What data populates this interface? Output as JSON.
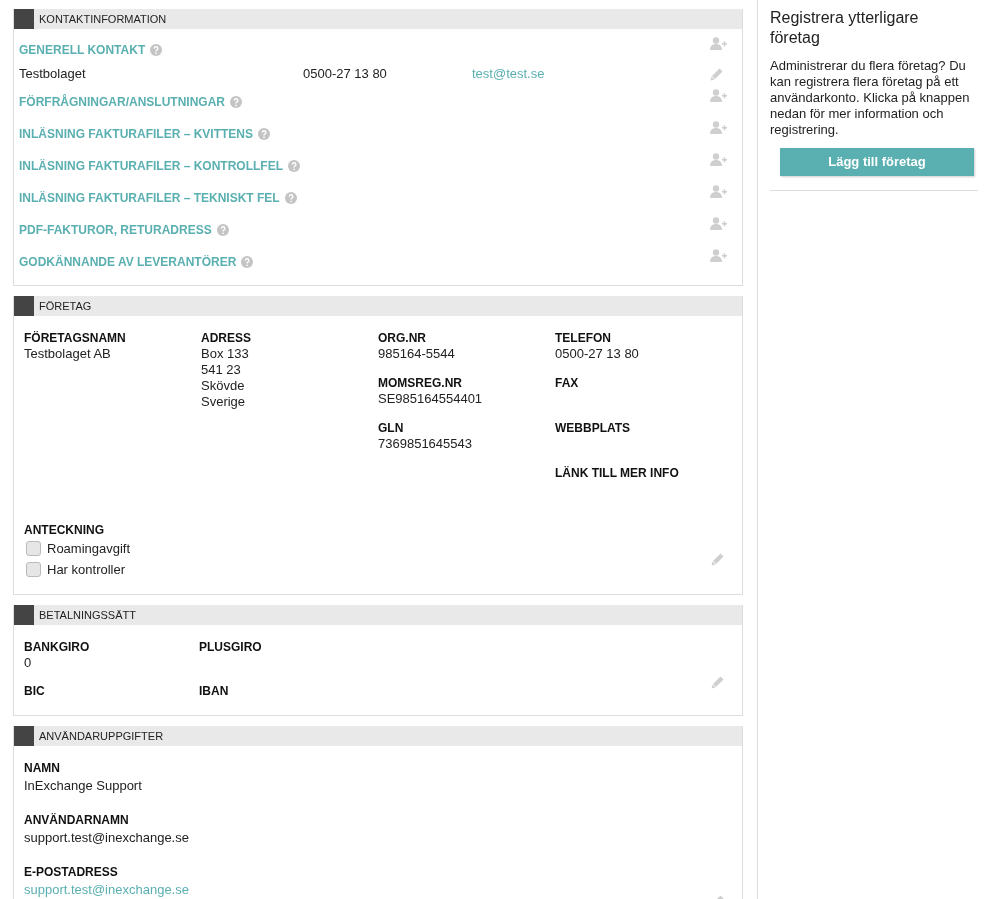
{
  "contact_section": {
    "title": "KONTAKTINFORMATION",
    "groups": [
      {
        "title": "GENERELL KONTAKT",
        "contacts": [
          {
            "name": "Testbolaget",
            "phone": "0500-27 13 80",
            "email": "test@test.se"
          }
        ]
      },
      {
        "title": "FÖRFRÅGNINGAR/ANSLUTNINGAR"
      },
      {
        "title": "INLÄSNING FAKTURAFILER – KVITTENS"
      },
      {
        "title": "INLÄSNING FAKTURAFILER – KONTROLLFEL"
      },
      {
        "title": "INLÄSNING FAKTURAFILER – TEKNISKT FEL"
      },
      {
        "title": "PDF-FAKTUROR, RETURADRESS"
      },
      {
        "title": "GODKÄNNANDE AV LEVERANTÖRER"
      }
    ]
  },
  "company_section": {
    "title": "FÖRETAG",
    "columns": [
      [
        {
          "label": "FÖRETAGSNAMN",
          "values": [
            "Testbolaget AB"
          ]
        }
      ],
      [
        {
          "label": "ADRESS",
          "values": [
            "Box 133",
            "541 23",
            "Skövde",
            "Sverige"
          ]
        }
      ],
      [
        {
          "label": "ORG.NR",
          "values": [
            "985164-5544"
          ]
        },
        {
          "label": "MOMSREG.NR",
          "values": [
            "SE985164554401"
          ]
        },
        {
          "label": "GLN",
          "values": [
            "7369851645543"
          ]
        }
      ],
      [
        {
          "label": "TELEFON",
          "values": [
            "0500-27 13 80"
          ]
        },
        {
          "label": "FAX"
        },
        {
          "label": "WEBBPLATS"
        },
        {
          "label": "LÄNK TILL MER INFO"
        }
      ]
    ],
    "note_label": "ANTECKNING",
    "checkboxes": [
      {
        "label": "Roamingavgift",
        "checked": false
      },
      {
        "label": "Har kontroller",
        "checked": false
      }
    ]
  },
  "payment_section": {
    "title": "BETALNINGSSÄTT",
    "fields": [
      {
        "label": "BANKGIRO",
        "value": "0"
      },
      {
        "label": "PLUSGIRO"
      },
      {
        "label": "BIC"
      },
      {
        "label": "IBAN"
      }
    ]
  },
  "user_section": {
    "title": "ANVÄNDARUPPGIFTER",
    "fields": [
      {
        "label": "NAMN",
        "value": "InExchange Support",
        "kind": "text"
      },
      {
        "label": "ANVÄNDARNAMN",
        "value": "support.test@inexchange.se",
        "kind": "text"
      },
      {
        "label": "E-POSTADRESS",
        "value": "support.test@inexchange.se",
        "kind": "link"
      }
    ]
  },
  "sidebar": {
    "title": "Registrera ytterligare företag",
    "text": "Administrerar du flera företag? Du kan registrera flera företag på ett användarkonto. Klicka på knappen nedan för mer information och registrering.",
    "button": "Lägg till företag"
  }
}
